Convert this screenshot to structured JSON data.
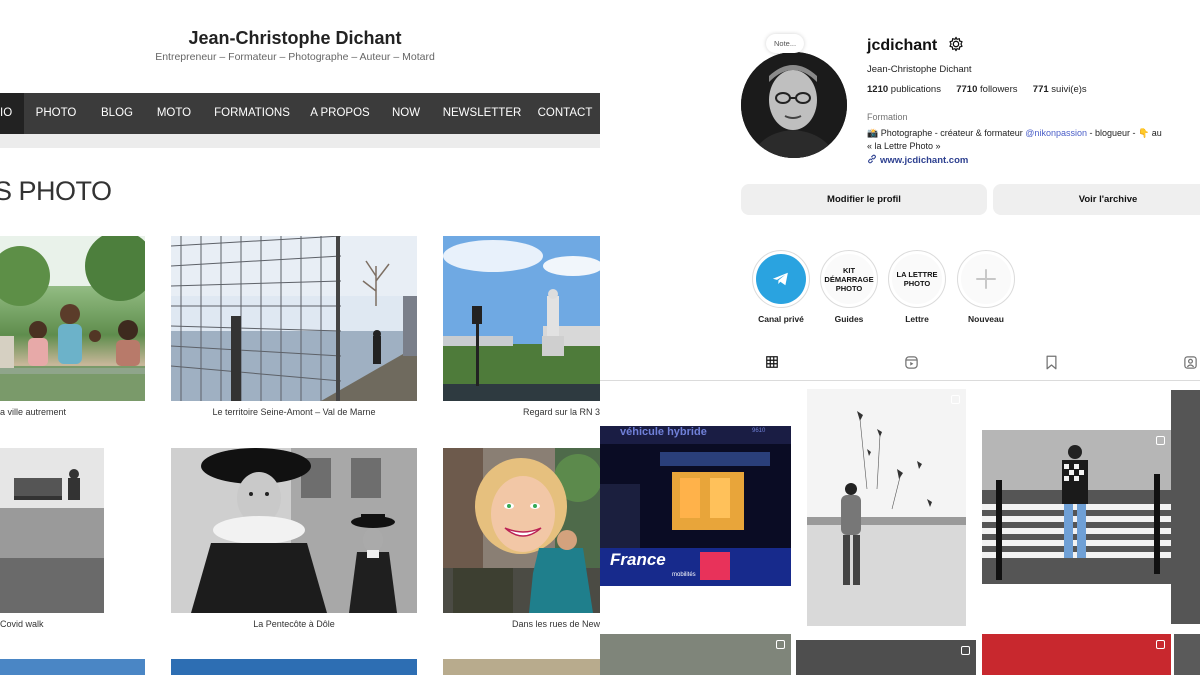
{
  "website": {
    "title": "Jean-Christophe Dichant",
    "tagline": "Entrepreneur – Formateur – Photographe – Auteur – Motard",
    "nav": {
      "partial_first": "IO",
      "items": [
        "PHOTO",
        "BLOG",
        "MOTO",
        "FORMATIONS",
        "A PROPOS",
        "NOW",
        "NEWSLETTER",
        "CONTACT"
      ]
    },
    "section_title": "S PHOTO",
    "captions": [
      "a ville autrement",
      "Le territoire Seine-Amont – Val de Marne",
      "Regard sur la RN 3",
      "Covid walk",
      "La Pentecôte à Dôle",
      "Dans les rues de New"
    ]
  },
  "instagram": {
    "note": "Note...",
    "username": "jcdichant",
    "full_name": "Jean-Christophe Dichant",
    "stats": {
      "publications_count": "1210",
      "publications_label": "publications",
      "followers_count": "7710",
      "followers_label": "followers",
      "following_count": "771",
      "following_label": "suivi(e)s"
    },
    "category": "Formation",
    "bio": {
      "line1_prefix": "📸 Photographe - créateur & formateur ",
      "mention": "@nikonpassion",
      "line1_suffix": " - blogueur - 👇 au",
      "line2": "« la Lettre Photo »"
    },
    "website_link": "www.jcdichant.com",
    "buttons": {
      "edit_profile": "Modifier le profil",
      "archive": "Voir l'archive"
    },
    "highlights": [
      {
        "cover_text": "",
        "label": "Canal privé"
      },
      {
        "cover_text": "KIT DÉMARRAGE PHOTO",
        "label": "Guides"
      },
      {
        "cover_text": "LA LETTRE PHOTO",
        "label": "Lettre"
      },
      {
        "cover_text": "",
        "label": "Nouveau"
      }
    ],
    "grid_overlay": {
      "sign_top": "véhicule hybride",
      "sign_num": "9610",
      "brand": "France",
      "brand_sub": "mobilités"
    }
  },
  "colors": {
    "nav_bg": "#3b3b3b",
    "nav_active": "#222222",
    "telegram_blue": "#2aa3e0",
    "mention_blue": "#4a5ec8"
  }
}
